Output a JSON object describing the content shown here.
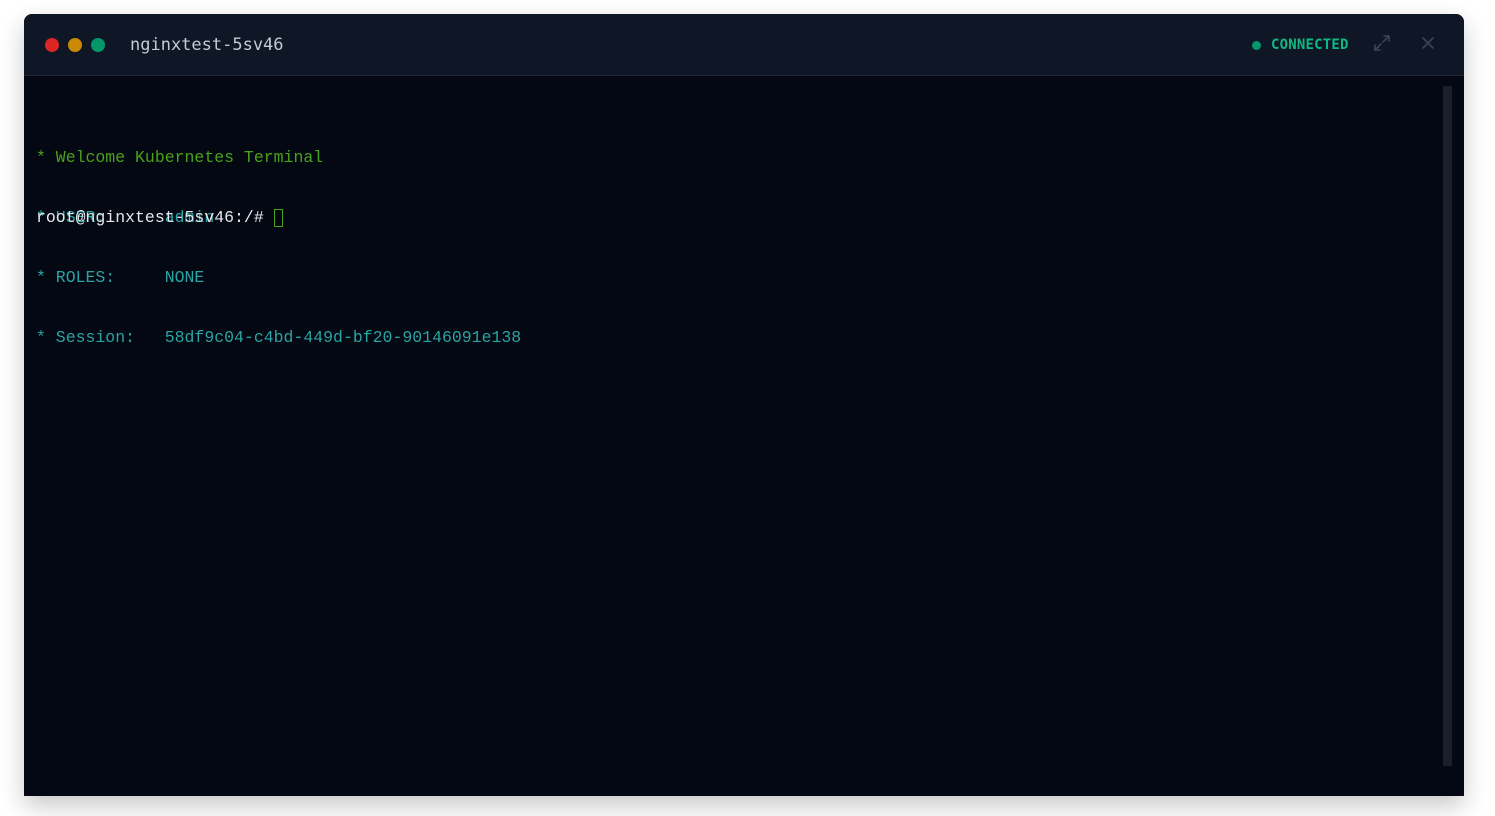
{
  "window": {
    "title": "nginxtest-5sv46",
    "traffic_lights": {
      "close_color": "#dc2626",
      "minimize_color": "#ca8a04",
      "maximize_color": "#059669"
    },
    "status": {
      "label": "CONNECTED",
      "color": "#10b981",
      "dot_color": "#059669"
    },
    "icons": {
      "expand": "expand-icon",
      "close": "close-icon"
    }
  },
  "terminal": {
    "colors": {
      "welcome": "#4aa21b",
      "info": "#2aa4a4",
      "prompt": "#e5e7eb",
      "cursor_border": "#4aa21b"
    },
    "lines": [
      {
        "text": "* Welcome Kubernetes Terminal"
      },
      {
        "text": "* USER:      admin"
      },
      {
        "text": "* ROLES:     NONE"
      },
      {
        "text": "* Session:   58df9c04-c4bd-449d-bf20-90146091e138"
      }
    ],
    "prompt": "root@nginxtest-5sv46:/#"
  }
}
